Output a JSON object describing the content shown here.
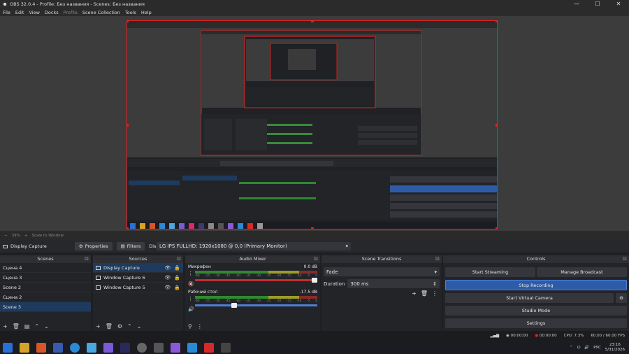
{
  "window": {
    "title": "OBS 32.0.4 - Profile: Без названия - Scenes: Без названия",
    "minimize": "—",
    "maximize": "☐",
    "close": "✕"
  },
  "menu": [
    "File",
    "Edit",
    "View",
    "Docks",
    "Profile",
    "Scene Collection",
    "Tools",
    "Help"
  ],
  "preview_status": {
    "zoom": "39%",
    "scale": "Scale to Window"
  },
  "properties_bar": {
    "source_name": "Display Capture",
    "properties_label": "Properties",
    "filters_label": "Filters",
    "display_label": "Display",
    "display_value": "LG IPS FULLHD: 1920x1080 @ 0,0 (Primary Monitor)"
  },
  "scenes": {
    "title": "Scenes",
    "items": [
      "Сцена 4",
      "Сцена 3",
      "Scene 2",
      "Сцена 2",
      "Scene 3"
    ],
    "selected": "Scene 3"
  },
  "sources": {
    "title": "Sources",
    "items": [
      "Display Capture",
      "Window Capture 6",
      "Window Capture 5"
    ],
    "selected": "Display Capture"
  },
  "audio_mixer": {
    "title": "Audio Mixer",
    "channels": [
      {
        "name": "Микрофон",
        "db": "0.0 dB",
        "level": 0.0,
        "volume": 1.0
      },
      {
        "name": "Рабочий стол",
        "db": "-17.5 dB",
        "level": 0.58,
        "volume": 0.34
      }
    ],
    "ticks": [
      "-60",
      "-55",
      "-50",
      "-45",
      "-40",
      "-35",
      "-30",
      "-25",
      "-20",
      "-15",
      "-10",
      "-5",
      "0"
    ]
  },
  "transitions": {
    "title": "Scene Transitions",
    "type": "Fade",
    "duration_label": "Duration",
    "duration_value": "300 ms"
  },
  "controls": {
    "title": "Controls",
    "start_streaming": "Start Streaming",
    "manage_broadcast": "Manage Broadcast",
    "stop_recording": "Stop Recording",
    "start_virtual_camera": "Start Virtual Camera",
    "studio_mode": "Studio Mode",
    "settings": "Settings"
  },
  "status": {
    "stream_time": "00:00:00",
    "rec_time": "00:00:00",
    "cpu": "CPU: 7.3%",
    "fps": "60.00 / 60.00 FPS"
  },
  "tray": {
    "lang": "РУС",
    "time": "23:16",
    "date": "5/31/2026"
  },
  "colors": {
    "accent": "#2e5ba8",
    "record_red": "#e62020",
    "bg": "#1e1f22"
  }
}
